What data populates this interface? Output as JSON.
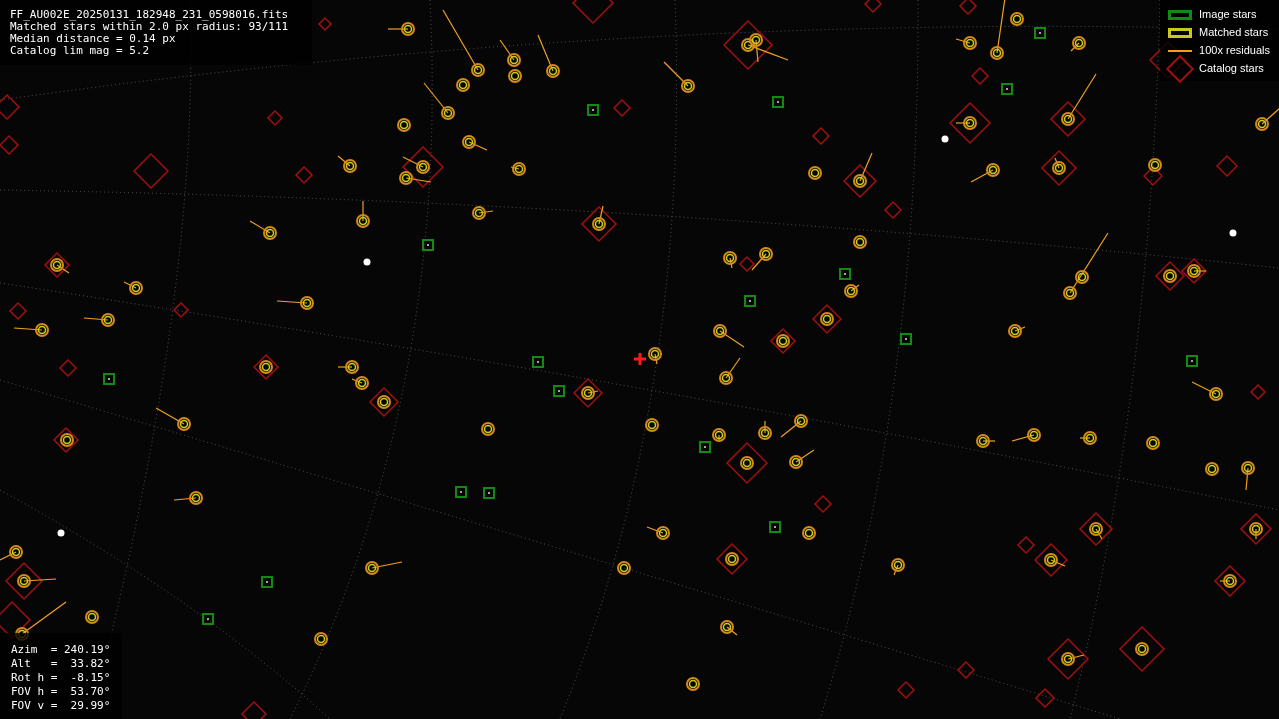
{
  "file_info": {
    "lines": [
      "FF_AU002E_20250131_182948_231_0598016.fits",
      "Matched stars within 2.0 px radius: 93/111",
      "Median distance = 0.14 px",
      "Catalog lim mag = 5.2"
    ]
  },
  "legend": [
    {
      "label": "Image stars",
      "kind": "box",
      "color": "#138a13"
    },
    {
      "label": "Matched stars",
      "kind": "box",
      "color": "#c8c81e"
    },
    {
      "label": "100x residuals",
      "kind": "line",
      "color": "#f0a020"
    },
    {
      "label": "Catalog stars",
      "kind": "diamond",
      "color": "#a01010"
    }
  ],
  "pointing": {
    "lines": [
      "Azim  = 240.19°",
      "Alt   =  33.82°",
      "Rot h =  -8.15°",
      "FOV h =  53.70°",
      "FOV v =  29.99°"
    ]
  }
}
